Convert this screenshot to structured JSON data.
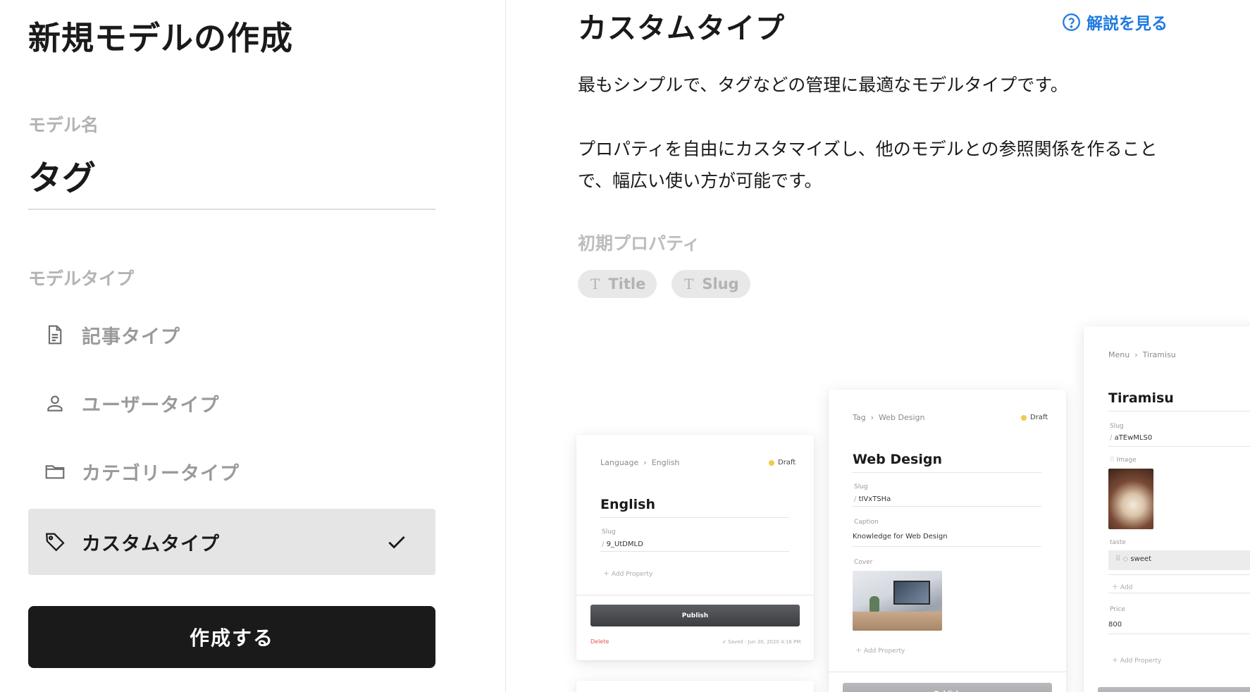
{
  "left": {
    "title": "新規モデルの作成",
    "name_label": "モデル名",
    "name_value": "タグ",
    "type_label": "モデルタイプ",
    "types": [
      {
        "label": "記事タイプ",
        "icon": "document-icon",
        "selected": false
      },
      {
        "label": "ユーザータイプ",
        "icon": "user-icon",
        "selected": false
      },
      {
        "label": "カテゴリータイプ",
        "icon": "folder-icon",
        "selected": false
      },
      {
        "label": "カスタムタイプ",
        "icon": "tag-icon",
        "selected": true
      }
    ],
    "create_button": "作成する"
  },
  "right": {
    "title": "カスタムタイプ",
    "help_link": "解説を見る",
    "desc1": "最もシンプルで、タグなどの管理に最適なモデルタイプです。",
    "desc2": "プロパティを自由にカスタマイズし、他のモデルとの参照関係を作ることで、幅広い使い方が可能です。",
    "initial_props_label": "初期プロパティ",
    "initial_props": [
      {
        "icon": "T",
        "label": "Title"
      },
      {
        "icon": "T",
        "label": "Slug"
      }
    ]
  },
  "preview": {
    "card1": {
      "crumb_parent": "Language",
      "crumb_child": "English",
      "status": "Draft",
      "title": "English",
      "slug_label": "Slug",
      "slug_value": "9_UtDMLD",
      "add_property": "Add Property",
      "publish": "Publish",
      "delete": "Delete",
      "saved": "Saved : Jun 30, 2020 4:16 PM"
    },
    "card2": {
      "crumb_parent": "Tag",
      "crumb_child": "Web Design",
      "status": "Draft",
      "title": "Web Design",
      "slug_label": "Slug",
      "slug_value": "tIVxTSHa",
      "caption_label": "Caption",
      "caption_value": "Knowledge for Web Design",
      "cover_label": "Cover",
      "add_property": "Add Property",
      "publish": "Publish"
    },
    "card3": {
      "crumb_parent": "Menu",
      "crumb_child": "Tiramisu",
      "title": "Tiramisu",
      "slug_label": "Slug",
      "slug_value": "aTEwMLS0",
      "image_label": "Image",
      "taste_label": "taste",
      "taste_value": "sweet",
      "add": "Add",
      "price_label": "Price",
      "price_value": "800",
      "add_property": "Add Property"
    }
  },
  "colors": {
    "accent": "#1f7ae0",
    "selected_bg": "#e5e5e5",
    "button_bg": "#1a1a1a",
    "draft_dot": "#f2c94c",
    "delete": "#e55353"
  }
}
